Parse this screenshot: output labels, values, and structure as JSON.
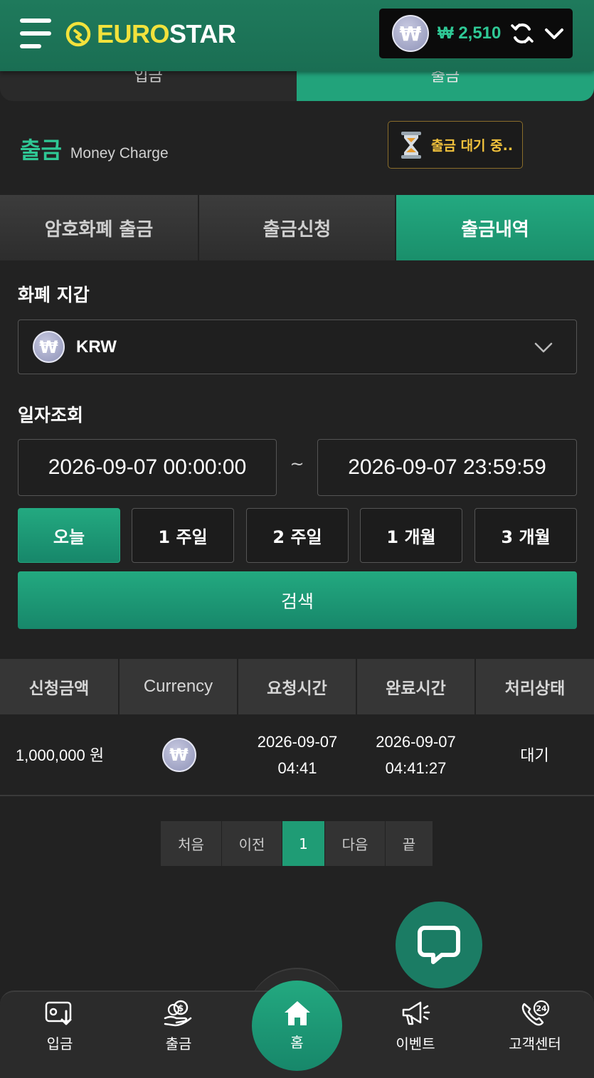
{
  "header": {
    "logo_euro": "EURO",
    "logo_star": "STAR",
    "balance": "₩ 2,510",
    "currency_symbol": "₩"
  },
  "subtabs": {
    "left": "입금",
    "right": "출금"
  },
  "page": {
    "title": "출금",
    "subtitle": "Money Charge",
    "pending_badge": "출금 대기 중.."
  },
  "tabs": [
    {
      "label": "암호화폐 출금"
    },
    {
      "label": "출금신청"
    },
    {
      "label": "출금내역"
    }
  ],
  "wallet": {
    "label": "화폐 지갑",
    "selected": "KRW",
    "currency_symbol": "₩"
  },
  "date_query": {
    "label": "일자조회",
    "from": "2026-09-07 00:00:00",
    "separator": "~",
    "to": "2026-09-07 23:59:59",
    "ranges": [
      "오늘",
      "1 주일",
      "2 주일",
      "1 개월",
      "3 개월"
    ],
    "search_label": "검색"
  },
  "table": {
    "headers": [
      "신청금액",
      "Currency",
      "요청시간",
      "완료시간",
      "처리상태"
    ],
    "rows": [
      {
        "amount": "1,000,000 원",
        "currency_symbol": "₩",
        "request_date": "2026-09-07",
        "request_time": "04:41",
        "complete_date": "2026-09-07",
        "complete_time": "04:41:27",
        "status": "대기"
      }
    ]
  },
  "pagination": {
    "first": "처음",
    "prev": "이전",
    "current": "1",
    "next": "다음",
    "last": "끝"
  },
  "bottom_nav": {
    "deposit": "입금",
    "withdraw": "출금",
    "home": "홈",
    "event": "이벤트",
    "support": "고객센터",
    "support_badge": "24"
  },
  "colors": {
    "accent": "#23a980",
    "header": "#1f7a5c",
    "logo_yellow": "#f2e23c",
    "pending_gold": "#f2c23c"
  }
}
